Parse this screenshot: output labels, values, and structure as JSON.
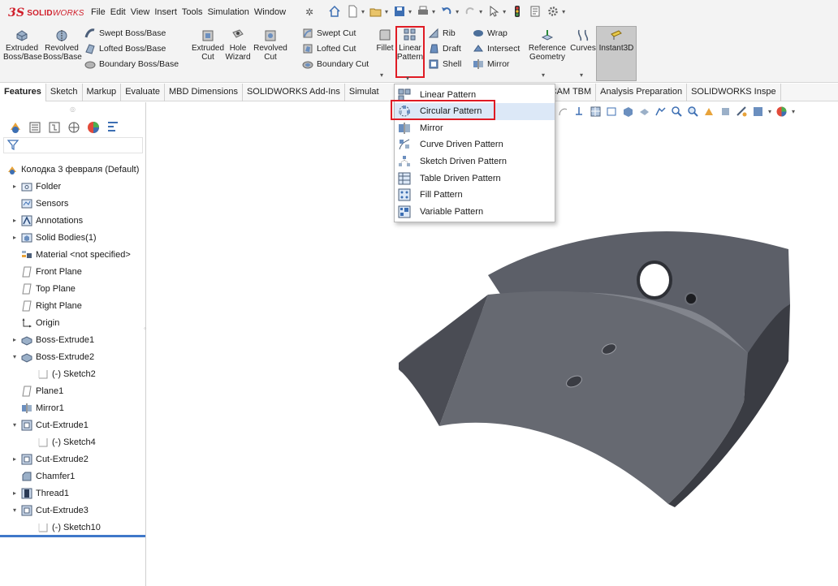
{
  "app": {
    "logo_brand": "SOLID",
    "logo_works": "WORKS"
  },
  "menu": [
    "File",
    "Edit",
    "View",
    "Insert",
    "Tools",
    "Simulation",
    "Window"
  ],
  "ribbon": {
    "extruded_boss": [
      "Extruded",
      "Boss/Base"
    ],
    "revolved_boss": [
      "Revolved",
      "Boss/Base"
    ],
    "swept_boss": "Swept Boss/Base",
    "lofted_boss": "Lofted Boss/Base",
    "boundary_boss": "Boundary Boss/Base",
    "extruded_cut": [
      "Extruded",
      "Cut"
    ],
    "hole_wizard": [
      "Hole",
      "Wizard"
    ],
    "revolved_cut": [
      "Revolved",
      "Cut"
    ],
    "swept_cut": "Swept Cut",
    "lofted_cut": "Lofted Cut",
    "boundary_cut": "Boundary Cut",
    "fillet": "Fillet",
    "linear_pattern": [
      "Linear",
      "Pattern"
    ],
    "rib": "Rib",
    "wrap": "Wrap",
    "draft": "Draft",
    "intersect": "Intersect",
    "shell": "Shell",
    "mirror": "Mirror",
    "reference_geometry": [
      "Reference",
      "Geometry"
    ],
    "curves": "Curves",
    "instant3d": "Instant3D"
  },
  "tabs": [
    {
      "label": "Features",
      "active": true
    },
    {
      "label": "Sketch",
      "active": false
    },
    {
      "label": "Markup",
      "active": false
    },
    {
      "label": "Evaluate",
      "active": false
    },
    {
      "label": "MBD Dimensions",
      "active": false
    },
    {
      "label": "SOLIDWORKS Add-Ins",
      "active": false
    },
    {
      "label": "Simulat",
      "active": false
    },
    {
      "label": "LIDWORKS CAM TBM",
      "active": false
    },
    {
      "label": "Analysis Preparation",
      "active": false
    },
    {
      "label": "SOLIDWORKS Inspe",
      "active": false
    }
  ],
  "pattern_menu": [
    {
      "label": "Linear Pattern",
      "icon": "linear-pattern-icon"
    },
    {
      "label": "Circular Pattern",
      "icon": "circular-pattern-icon",
      "highlighted": true
    },
    {
      "label": "Mirror",
      "icon": "mirror-icon"
    },
    {
      "label": "Curve Driven Pattern",
      "icon": "curve-pattern-icon"
    },
    {
      "label": "Sketch Driven Pattern",
      "icon": "sketch-pattern-icon"
    },
    {
      "label": "Table Driven Pattern",
      "icon": "table-pattern-icon"
    },
    {
      "label": "Fill Pattern",
      "icon": "fill-pattern-icon"
    },
    {
      "label": "Variable Pattern",
      "icon": "variable-pattern-icon"
    }
  ],
  "feature_tree": [
    {
      "label": "Колодка 3 февраля (Default)",
      "icon": "part-icon",
      "expand": "",
      "level": 0
    },
    {
      "label": "Folder",
      "icon": "folder-icon",
      "expand": "▸",
      "level": 1
    },
    {
      "label": "Sensors",
      "icon": "sensor-icon",
      "expand": "",
      "level": 1
    },
    {
      "label": "Annotations",
      "icon": "annotation-icon",
      "expand": "▸",
      "level": 1
    },
    {
      "label": "Solid Bodies(1)",
      "icon": "solid-bodies-icon",
      "expand": "▸",
      "level": 1
    },
    {
      "label": "Material <not specified>",
      "icon": "material-icon",
      "expand": "",
      "level": 1
    },
    {
      "label": "Front Plane",
      "icon": "plane-icon",
      "expand": "",
      "level": 1
    },
    {
      "label": "Top Plane",
      "icon": "plane-icon",
      "expand": "",
      "level": 1
    },
    {
      "label": "Right Plane",
      "icon": "plane-icon",
      "expand": "",
      "level": 1
    },
    {
      "label": "Origin",
      "icon": "origin-icon",
      "expand": "",
      "level": 1
    },
    {
      "label": "Boss-Extrude1",
      "icon": "boss-extrude-icon",
      "expand": "▸",
      "level": 1
    },
    {
      "label": "Boss-Extrude2",
      "icon": "boss-extrude-icon",
      "expand": "▾",
      "level": 1
    },
    {
      "label": "(-) Sketch2",
      "icon": "sketch-icon",
      "expand": "",
      "level": 2
    },
    {
      "label": "Plane1",
      "icon": "plane-icon",
      "expand": "",
      "level": 1
    },
    {
      "label": "Mirror1",
      "icon": "mirror-feature-icon",
      "expand": "",
      "level": 1
    },
    {
      "label": "Cut-Extrude1",
      "icon": "cut-extrude-icon",
      "expand": "▾",
      "level": 1
    },
    {
      "label": "(-) Sketch4",
      "icon": "sketch-icon",
      "expand": "",
      "level": 2
    },
    {
      "label": "Cut-Extrude2",
      "icon": "cut-extrude-icon",
      "expand": "▸",
      "level": 1
    },
    {
      "label": "Chamfer1",
      "icon": "chamfer-icon",
      "expand": "",
      "level": 1
    },
    {
      "label": "Thread1",
      "icon": "thread-icon",
      "expand": "▸",
      "level": 1
    },
    {
      "label": "Cut-Extrude3",
      "icon": "cut-extrude-icon",
      "expand": "▾",
      "level": 1
    },
    {
      "label": "(-) Sketch10",
      "icon": "sketch-icon",
      "expand": "",
      "level": 2
    }
  ],
  "colors": {
    "highlight_red": "#e01b24",
    "part_face_top": "#6a6d75",
    "part_face_front": "#5a5d66",
    "part_face_dark": "#3b3d44",
    "selection_blue": "#3f78c9"
  }
}
